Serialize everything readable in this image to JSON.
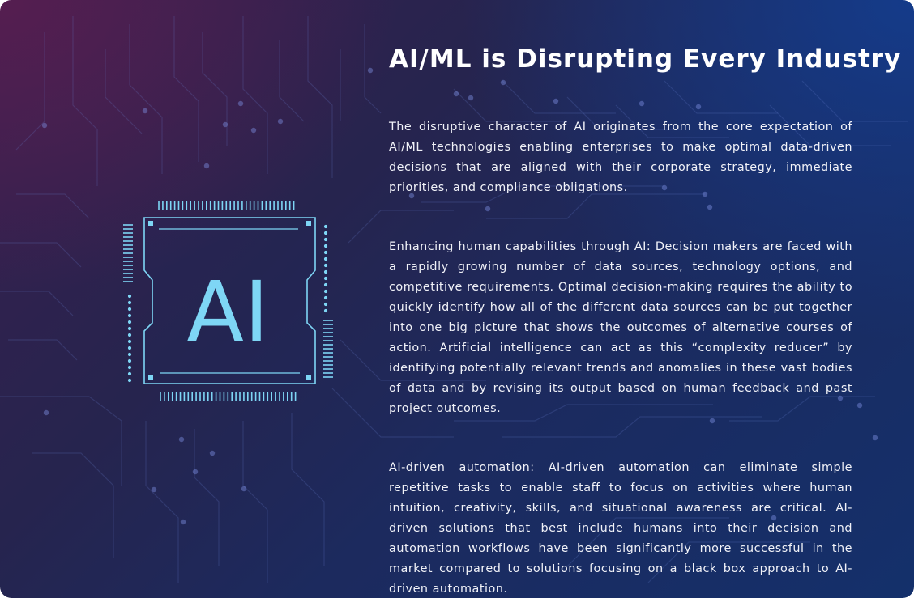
{
  "chip": {
    "label": "AI"
  },
  "content": {
    "title": "AI/ML is Disrupting Every Industry",
    "paragraphs": [
      "The disruptive character of AI originates from the core expectation of AI/ML technologies enabling enterprises to make optimal data-driven decisions that are aligned with their corporate strategy, immediate priorities, and compliance obligations.",
      "Enhancing human capabilities through AI: Decision makers are faced with a rapidly growing number of data sources, technology options, and competitive requirements. Optimal decision-making requires the ability to quickly identify how all of the different data sources can be put together into one big picture that shows the outcomes of alternative courses of action. Artificial intelligence can act as this “complexity reducer” by identifying potentially relevant trends and anomalies in these vast bodies of data and by revising its output based on human feedback and past project outcomes.",
      "AI-driven automation: AI-driven automation can eliminate simple repetitive tasks to enable staff to focus on activities where human intuition, creativity, skills, and situational awareness are critical. AI-driven solutions that best include humans into their decision and automation workflows have been significantly more successful in the market compared to solutions focusing on a black box approach to AI-driven automation."
    ]
  },
  "colors": {
    "accent": "#7ed6f5",
    "text": "#ffffff"
  }
}
